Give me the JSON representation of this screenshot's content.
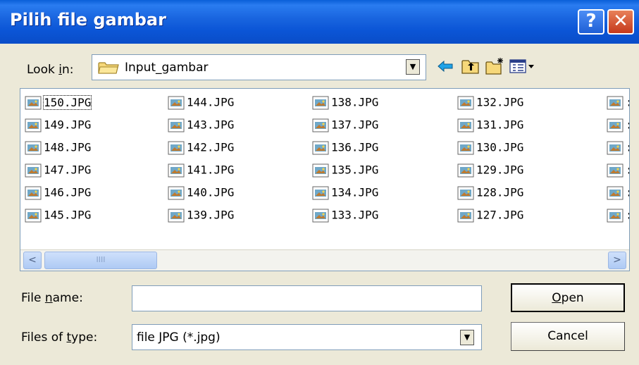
{
  "window": {
    "title": "Pilih file gambar",
    "help_glyph": "?",
    "close_glyph": "✕"
  },
  "toolbar": {
    "lookin_label_pre": "Look ",
    "lookin_label_accel": "i",
    "lookin_label_post": "n:",
    "lookin_value": "Input_gambar",
    "icons": [
      "back-arrow-icon",
      "up-one-level-icon",
      "new-folder-icon",
      "view-menu-icon"
    ]
  },
  "file_list": {
    "columns": [
      [
        "150.JPG",
        "149.JPG",
        "148.JPG",
        "147.JPG",
        "146.JPG",
        "145.JPG"
      ],
      [
        "144.JPG",
        "143.JPG",
        "142.JPG",
        "141.JPG",
        "140.JPG",
        "139.JPG"
      ],
      [
        "138.JPG",
        "137.JPG",
        "136.JPG",
        "135.JPG",
        "134.JPG",
        "133.JPG"
      ],
      [
        "132.JPG",
        "131.JPG",
        "130.JPG",
        "129.JPG",
        "128.JPG",
        "127.JPG"
      ],
      [
        ":",
        ":",
        ":",
        ":",
        ":",
        ":"
      ]
    ],
    "focused_item": "150.JPG",
    "scrollbar": {
      "left_glyph": "<",
      "right_glyph": ">",
      "thumb_grip": "IIII"
    }
  },
  "form": {
    "filename_label_pre": "File ",
    "filename_label_accel": "n",
    "filename_label_post": "ame:",
    "filename_value": "",
    "filetype_label_pre": "Files of ",
    "filetype_label_accel": "t",
    "filetype_label_post": "ype:",
    "filetype_value": "file JPG (*.jpg)",
    "open_accel": "O",
    "open_rest": "pen",
    "cancel_label": "Cancel"
  }
}
